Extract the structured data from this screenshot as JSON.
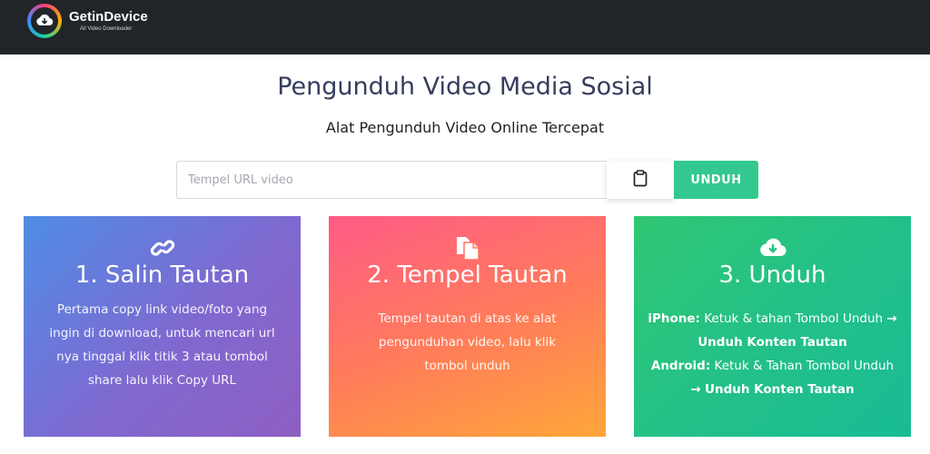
{
  "navbar": {
    "brand": "GetinDevice",
    "tagline": "All Video Downloader"
  },
  "hero": {
    "title": "Pengunduh Video Media Sosial",
    "subtitle": "Alat Pengunduh Video Online Tercepat"
  },
  "search": {
    "placeholder": "Tempel URL video",
    "value": "",
    "download_label": "UNDUH"
  },
  "icons": {
    "logo": "cloud-download-icon",
    "paste": "clipboard-icon",
    "step1": "link-icon",
    "step2": "paste-files-icon",
    "step3": "cloud-download-icon"
  },
  "colors": {
    "navbar": "#212529",
    "accent": "#33c88f",
    "title": "#343d5c"
  },
  "steps": [
    {
      "title": "1. Salin Tautan",
      "text": "Pertama copy link video/foto yang ingin di download, untuk mencari url nya tinggal klik titik 3 atau tombol share lalu klik Copy URL"
    },
    {
      "title": "2. Tempel Tautan",
      "text": "Tempel tautan di atas ke alat pengunduhan video, lalu klik tombol unduh"
    },
    {
      "title": "3. Unduh",
      "iphone_label": "iPhone:",
      "iphone_text": "Ketuk & tahan Tombol Unduh",
      "iphone_arrow": "→",
      "iphone_action": "Unduh Konten Tautan",
      "android_label": "Android:",
      "android_text": "Ketuk & Tahan Tombol Unduh",
      "android_arrow": "→",
      "android_action": "Unduh Konten Tautan"
    }
  ]
}
